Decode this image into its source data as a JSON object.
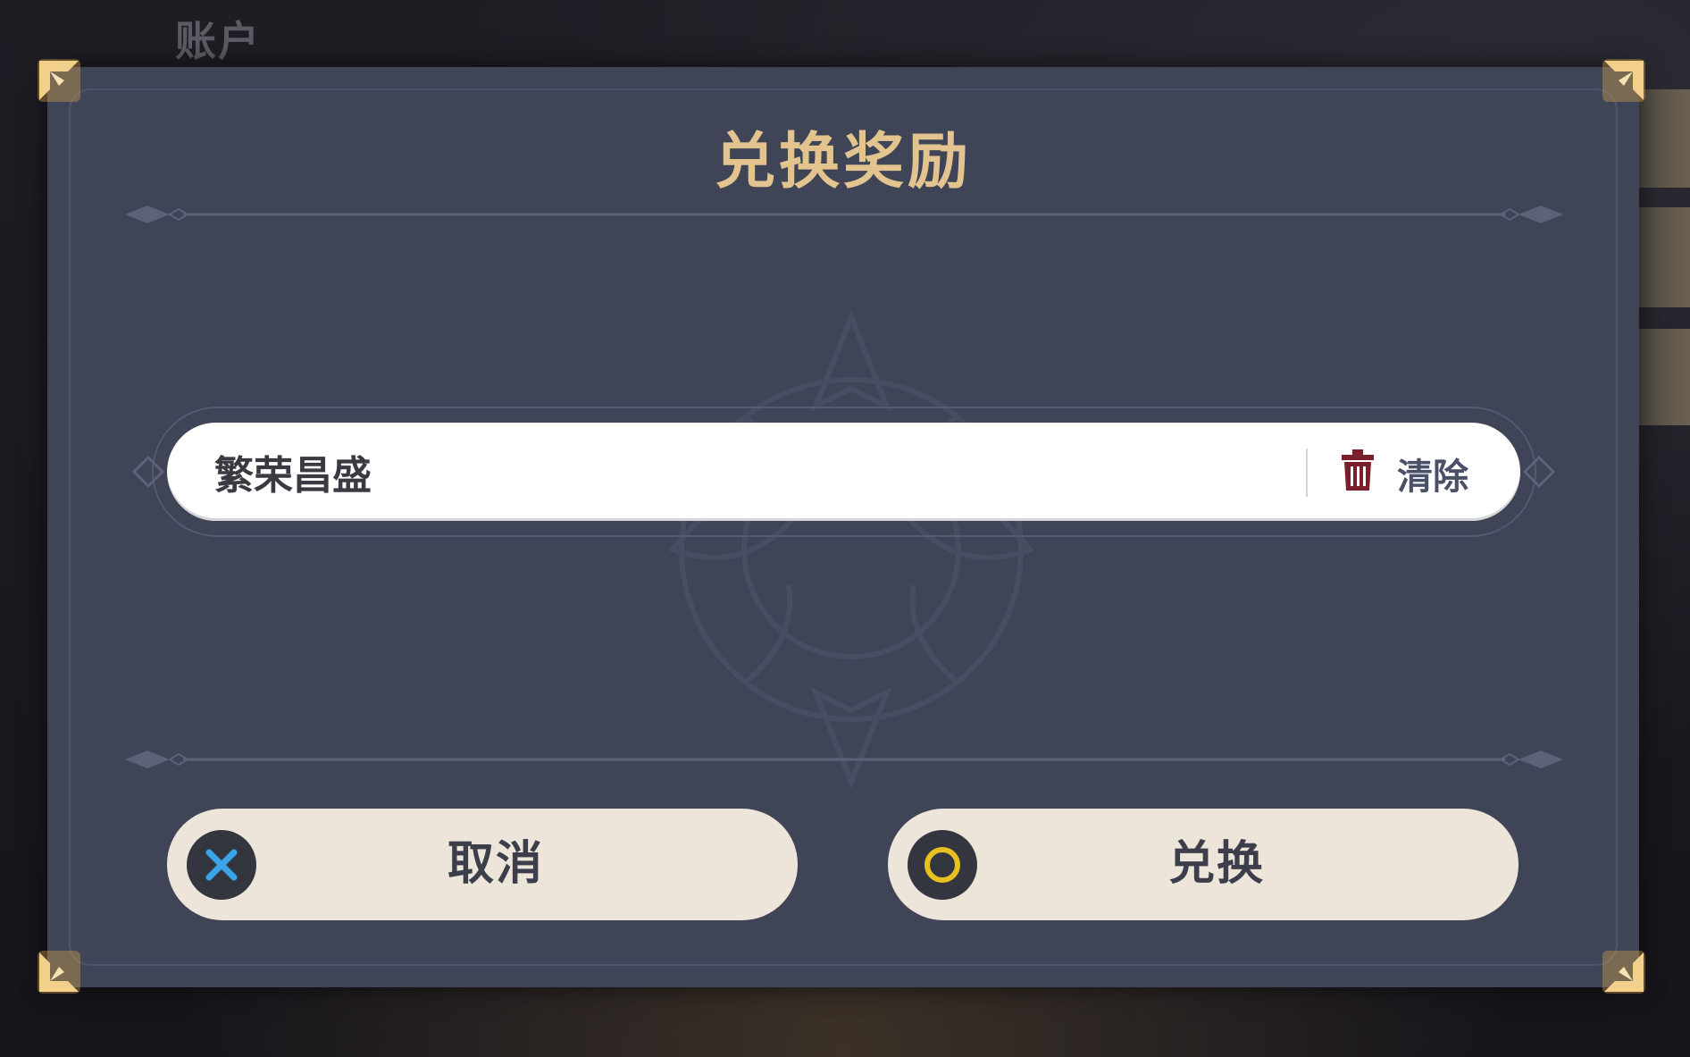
{
  "background": {
    "section_title": "账户"
  },
  "dialog": {
    "title": "兑换奖励",
    "code_input": {
      "value": "繁荣昌盛"
    },
    "clear_button": {
      "label": "清除",
      "icon": "trash-icon"
    },
    "cancel_button": {
      "label": "取消",
      "icon": "cross-button-icon"
    },
    "confirm_button": {
      "label": "兑换",
      "icon": "circle-button-icon"
    }
  },
  "colors": {
    "dialog_bg": "#3f4557",
    "title_gold": "#e3c48e",
    "button_bg": "#ede5da",
    "cross_blue": "#3aa4e8",
    "circle_yellow": "#e8c020",
    "trash_red": "#7a1f2a"
  }
}
